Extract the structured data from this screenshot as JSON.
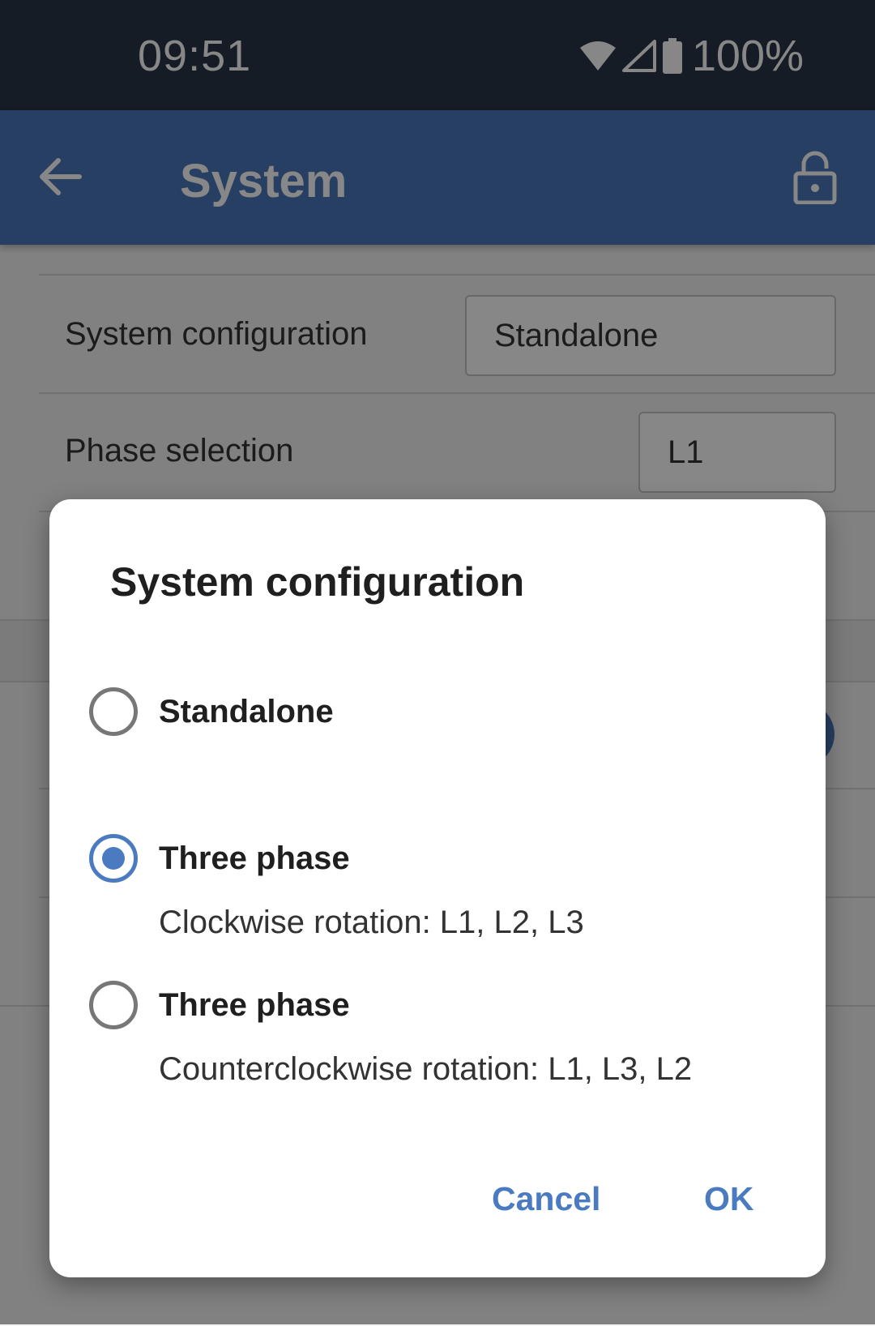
{
  "status_bar": {
    "time": "09:51",
    "battery": "100%",
    "icons": [
      "wifi-icon",
      "cellular-signal-icon",
      "battery-icon"
    ]
  },
  "app_bar": {
    "title": "System",
    "icons": [
      "back-arrow-icon",
      "lock-icon"
    ]
  },
  "settings": [
    {
      "label": "System configuration",
      "value": "Standalone"
    },
    {
      "label": "Phase selection",
      "value": "L1"
    }
  ],
  "dialog": {
    "title": "System configuration",
    "options": [
      {
        "label": "Standalone",
        "sublabel": "",
        "selected": false
      },
      {
        "label": "Three phase",
        "sublabel": "Clockwise rotation: L1, L2, L3",
        "selected": true
      },
      {
        "label": "Three phase",
        "sublabel": "Counterclockwise rotation: L1, L3, L2",
        "selected": false
      }
    ],
    "cancel_label": "Cancel",
    "ok_label": "OK"
  },
  "colors": {
    "status_bar": "#2a3548",
    "app_bar": "#4a78b9",
    "accent": "#4a7bc1"
  }
}
